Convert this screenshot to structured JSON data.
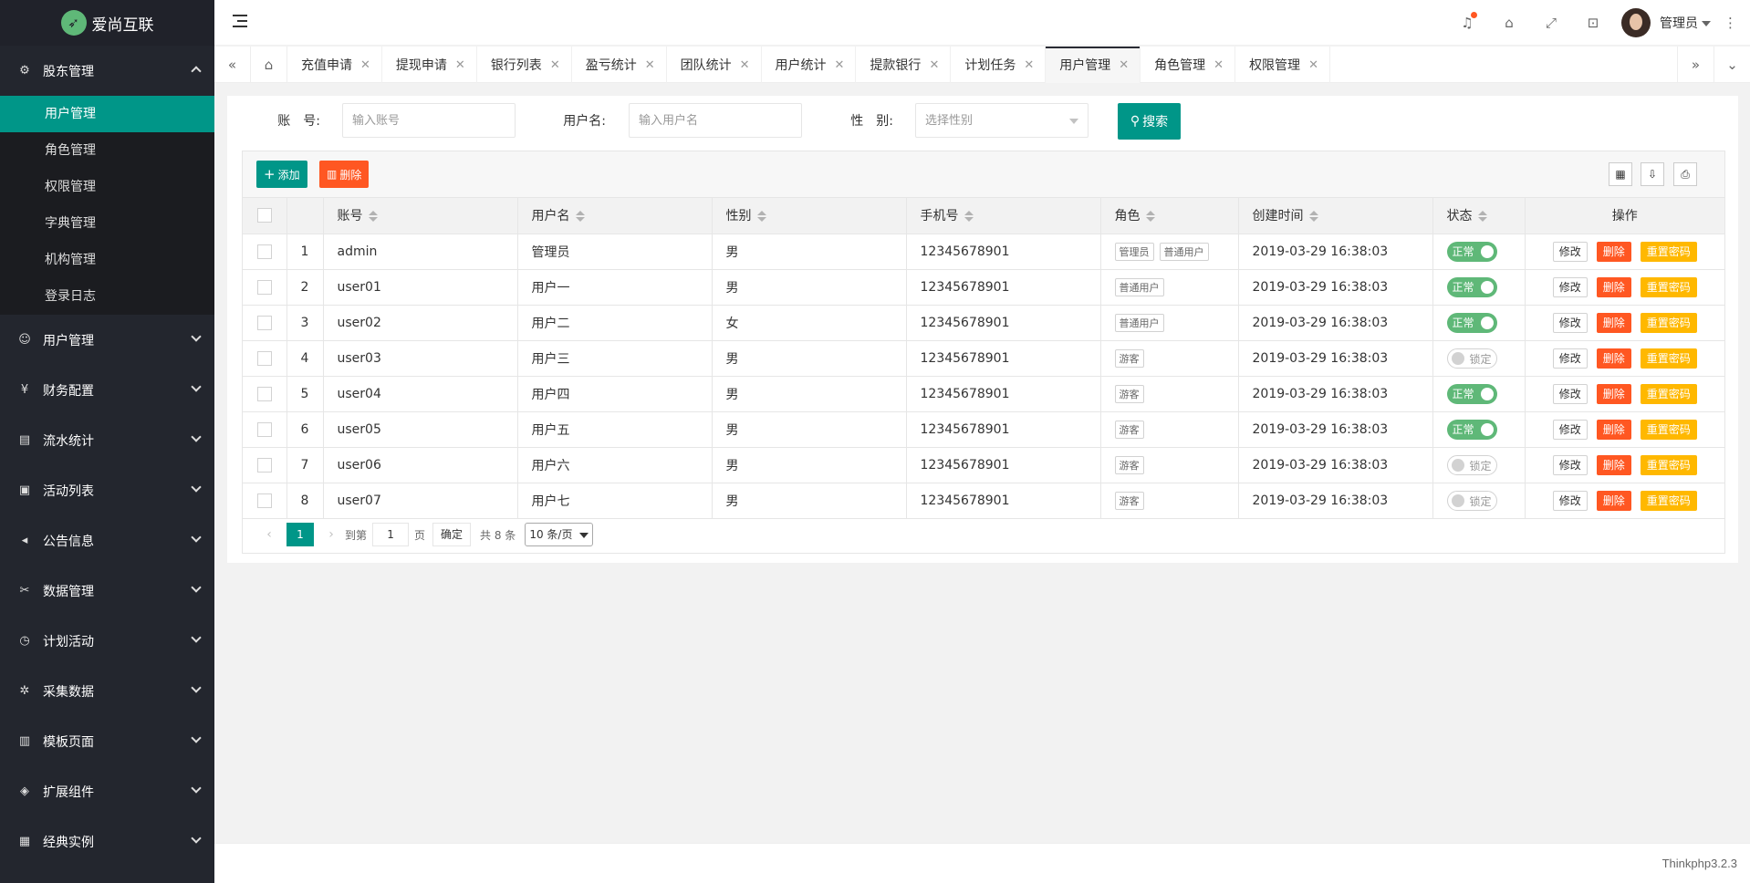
{
  "app": {
    "title": "爱尚互联"
  },
  "sidebar": {
    "groups": [
      {
        "label": "股东管理",
        "icon": "gear-icon",
        "glyph": "⚙",
        "open": true,
        "items": [
          {
            "label": "用户管理",
            "active": true
          },
          {
            "label": "角色管理"
          },
          {
            "label": "权限管理"
          },
          {
            "label": "字典管理"
          },
          {
            "label": "机构管理"
          },
          {
            "label": "登录日志"
          }
        ]
      },
      {
        "label": "用户管理",
        "icon": "user-icon",
        "glyph": "☺"
      },
      {
        "label": "财务配置",
        "icon": "yen-icon",
        "glyph": "¥"
      },
      {
        "label": "流水统计",
        "icon": "ledger-icon",
        "glyph": "▤"
      },
      {
        "label": "活动列表",
        "icon": "gift-icon",
        "glyph": "▣"
      },
      {
        "label": "公告信息",
        "icon": "speaker-icon",
        "glyph": "◂"
      },
      {
        "label": "数据管理",
        "icon": "tools-icon",
        "glyph": "✂"
      },
      {
        "label": "计划活动",
        "icon": "clock-icon",
        "glyph": "◷"
      },
      {
        "label": "采集数据",
        "icon": "collect-icon",
        "glyph": "✲"
      },
      {
        "label": "模板页面",
        "icon": "template-icon",
        "glyph": "▥"
      },
      {
        "label": "扩展组件",
        "icon": "cube-icon",
        "glyph": "◈"
      },
      {
        "label": "经典实例",
        "icon": "apps-icon",
        "glyph": "▦"
      }
    ]
  },
  "header": {
    "user": "管理员"
  },
  "tabs": {
    "items": [
      {
        "label": "充值申请"
      },
      {
        "label": "提现申请"
      },
      {
        "label": "银行列表"
      },
      {
        "label": "盈亏统计"
      },
      {
        "label": "团队统计"
      },
      {
        "label": "用户统计"
      },
      {
        "label": "提款银行"
      },
      {
        "label": "计划任务"
      },
      {
        "label": "用户管理",
        "active": true
      },
      {
        "label": "角色管理"
      },
      {
        "label": "权限管理"
      }
    ]
  },
  "search": {
    "account_label": "账　号:",
    "account_placeholder": "输入账号",
    "username_label": "用户名:",
    "username_placeholder": "输入用户名",
    "gender_label": "性　别:",
    "gender_placeholder": "选择性别",
    "button": "搜索"
  },
  "toolbar": {
    "add": "添加",
    "delete": "删除"
  },
  "table": {
    "columns": [
      "账号",
      "用户名",
      "性别",
      "手机号",
      "角色",
      "创建时间",
      "状态",
      "操作"
    ],
    "rows": [
      {
        "no": "1",
        "account": "admin",
        "username": "管理员",
        "gender": "男",
        "phone": "12345678901",
        "roles": [
          "管理员",
          "普通用户"
        ],
        "created": "2019-03-29 16:38:03",
        "status": "正常",
        "on": true
      },
      {
        "no": "2",
        "account": "user01",
        "username": "用户一",
        "gender": "男",
        "phone": "12345678901",
        "roles": [
          "普通用户"
        ],
        "created": "2019-03-29 16:38:03",
        "status": "正常",
        "on": true
      },
      {
        "no": "3",
        "account": "user02",
        "username": "用户二",
        "gender": "女",
        "phone": "12345678901",
        "roles": [
          "普通用户"
        ],
        "created": "2019-03-29 16:38:03",
        "status": "正常",
        "on": true
      },
      {
        "no": "4",
        "account": "user03",
        "username": "用户三",
        "gender": "男",
        "phone": "12345678901",
        "roles": [
          "游客"
        ],
        "created": "2019-03-29 16:38:03",
        "status": "锁定",
        "on": false
      },
      {
        "no": "5",
        "account": "user04",
        "username": "用户四",
        "gender": "男",
        "phone": "12345678901",
        "roles": [
          "游客"
        ],
        "created": "2019-03-29 16:38:03",
        "status": "正常",
        "on": true
      },
      {
        "no": "6",
        "account": "user05",
        "username": "用户五",
        "gender": "男",
        "phone": "12345678901",
        "roles": [
          "游客"
        ],
        "created": "2019-03-29 16:38:03",
        "status": "正常",
        "on": true
      },
      {
        "no": "7",
        "account": "user06",
        "username": "用户六",
        "gender": "男",
        "phone": "12345678901",
        "roles": [
          "游客"
        ],
        "created": "2019-03-29 16:38:03",
        "status": "锁定",
        "on": false
      },
      {
        "no": "8",
        "account": "user07",
        "username": "用户七",
        "gender": "男",
        "phone": "12345678901",
        "roles": [
          "游客"
        ],
        "created": "2019-03-29 16:38:03",
        "status": "锁定",
        "on": false
      }
    ],
    "actions": {
      "edit": "修改",
      "delete": "删除",
      "reset": "重置密码"
    }
  },
  "pager": {
    "current": "1",
    "goto_label": "到第",
    "goto_value": "1",
    "page_unit": "页",
    "confirm": "确定",
    "total": "共 8 条",
    "page_size": "10 条/页"
  },
  "footer": {
    "text": "Thinkphp3.2.3"
  },
  "colors": {
    "primary": "#009688",
    "danger": "#ff5722",
    "warn": "#ffb800",
    "success": "#5fb878",
    "sidebar": "#23262e"
  }
}
